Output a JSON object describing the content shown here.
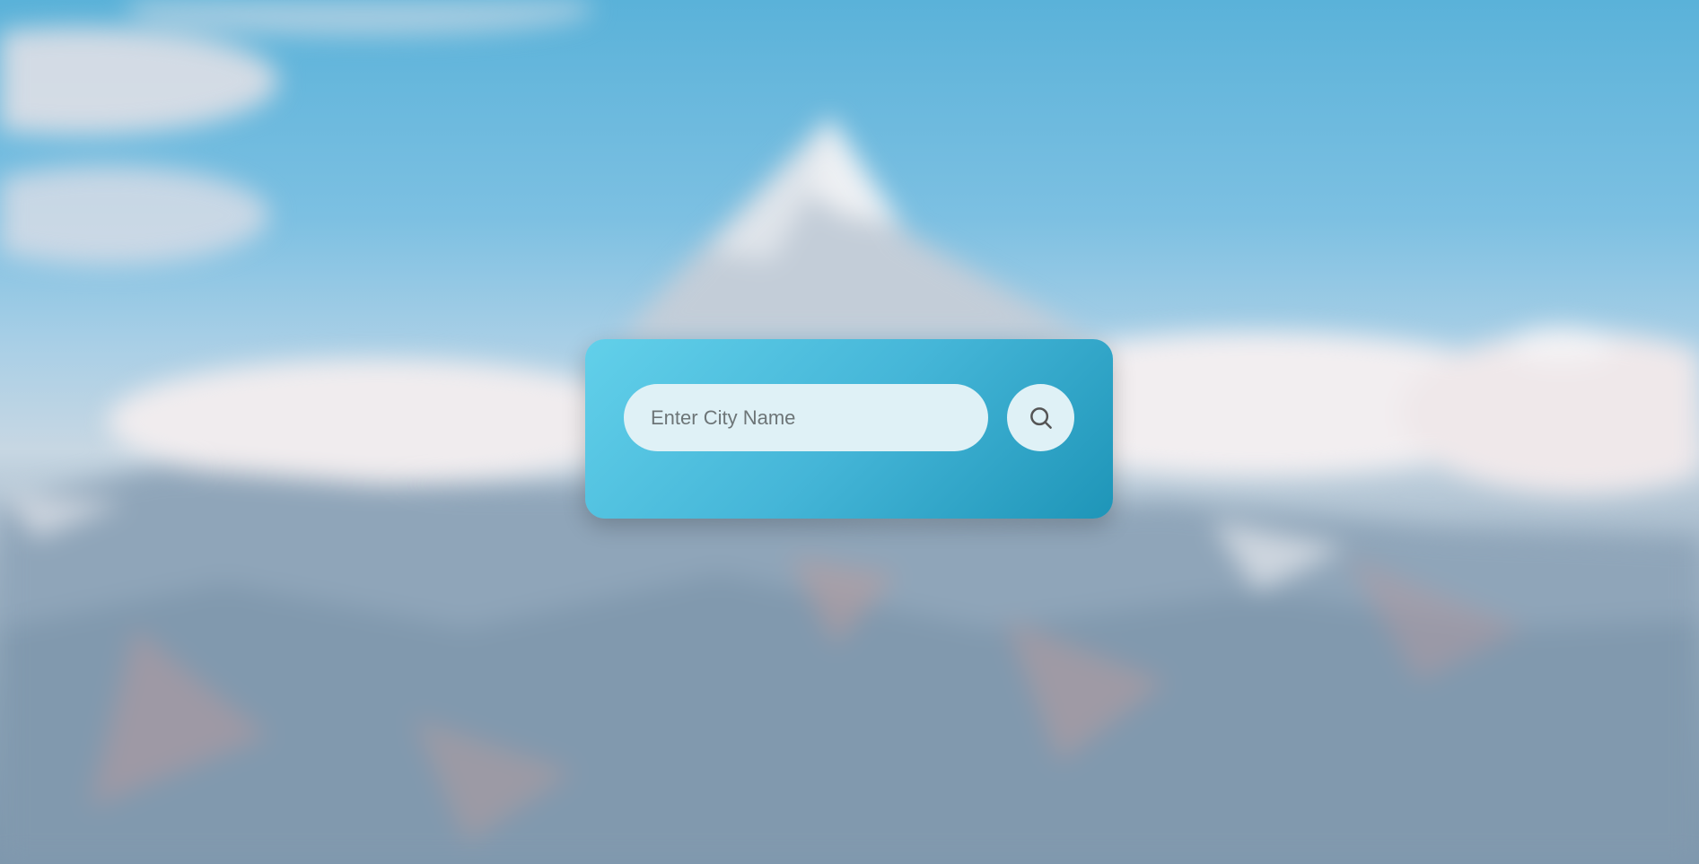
{
  "search": {
    "placeholder": "Enter City Name",
    "value": "",
    "button_icon": "search-icon"
  },
  "colors": {
    "card_gradient_start": "#62d0ea",
    "card_gradient_end": "#1e95b8",
    "input_background": "#dff1f6",
    "placeholder_text": "#6d7577",
    "icon_stroke": "#555555"
  }
}
